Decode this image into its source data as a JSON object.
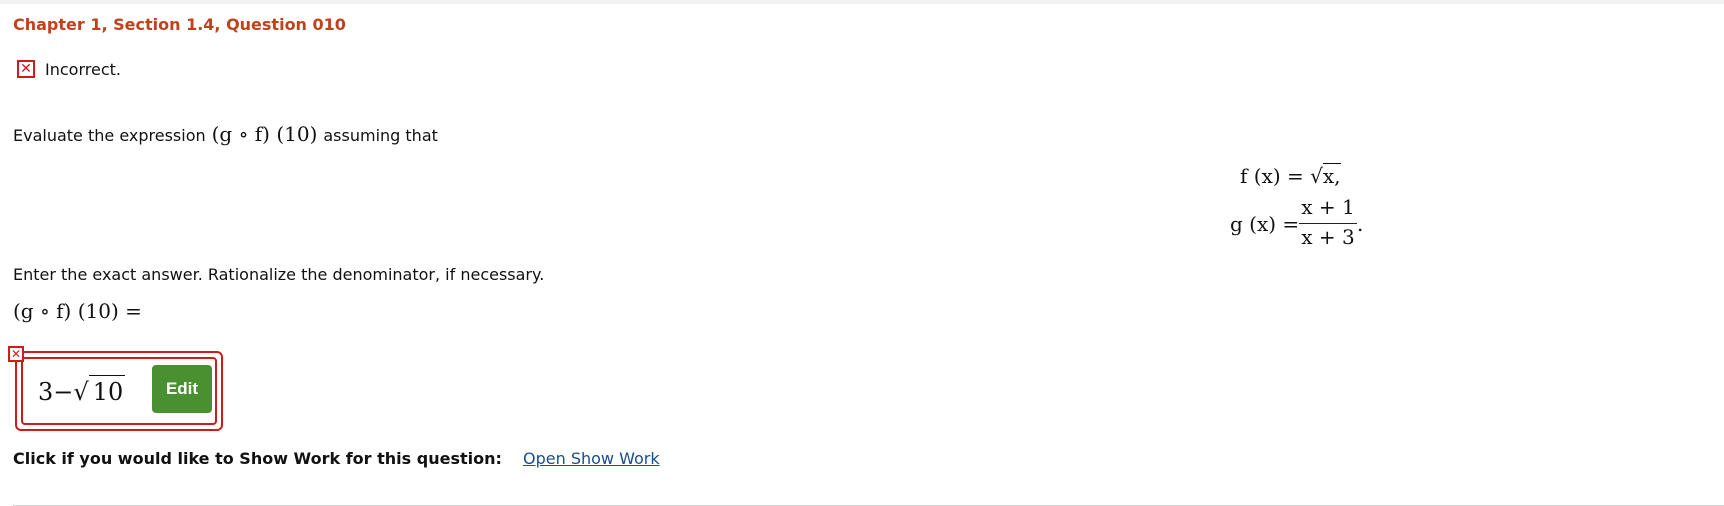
{
  "header": {
    "title": "Chapter 1, Section 1.4, Question 010"
  },
  "status": {
    "icon": "x-icon",
    "text": "Incorrect."
  },
  "question": {
    "prompt_prefix": "Evaluate the expression",
    "prompt_expr": "(g ∘ f) (10)",
    "prompt_suffix": "assuming that",
    "f_def": {
      "lhs": "f (x) =",
      "rhs": "x,"
    },
    "g_def": {
      "lhs": "g (x) =",
      "numerator": "x + 1",
      "denominator": "x + 3",
      "terminator": "."
    },
    "instructions": "Enter the exact answer. Rationalize the denominator, if necessary.",
    "answer_label": "(g ∘ f) (10) ="
  },
  "answer": {
    "value_prefix": "3−",
    "value_radicand": "10",
    "edit_label": "Edit",
    "status_icon": "x-icon"
  },
  "show_work": {
    "label": "Click if you would like to Show Work for this question:",
    "link": "Open Show Work"
  },
  "colors": {
    "title": "#c0421c",
    "error": "#d11a1a",
    "edit_button": "#4a8f30",
    "link": "#1a4d8c"
  }
}
